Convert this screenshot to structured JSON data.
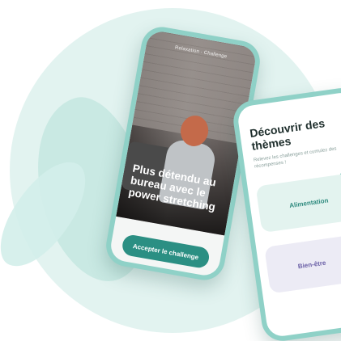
{
  "phone1": {
    "status_text": "Relaxation · Challenge",
    "headline": "Plus détendu au bureau avec le power stretching",
    "cta_label": "Accepter le challenge"
  },
  "phone2": {
    "title": "Découvrir des thèmes",
    "subtitle": "Relevez les challenges et cumulez des récompenses !",
    "cards": [
      {
        "label": "Alimentation"
      },
      {
        "label": "Bien-être"
      }
    ]
  },
  "colors": {
    "accent": "#2b8f83",
    "phone_frame": "#8fd1c7",
    "background_circle": "#e2f3f0"
  }
}
